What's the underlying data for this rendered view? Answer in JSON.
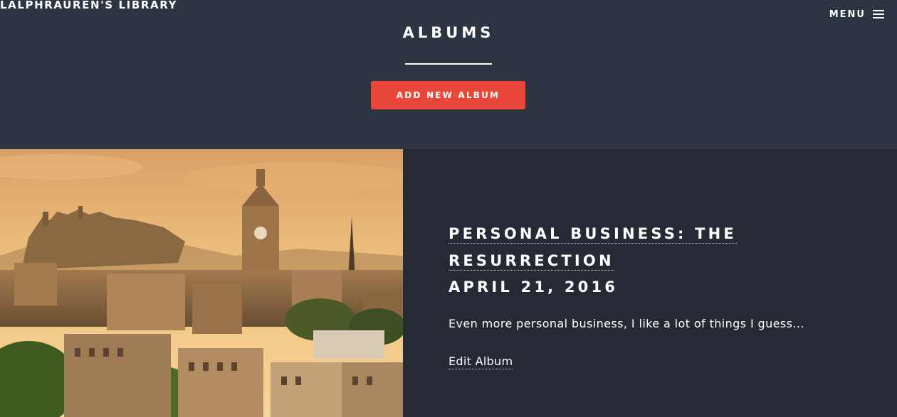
{
  "header": {
    "site_title": "LALPHRAUREN'S LIBRARY",
    "menu_label": "MENU",
    "menu_icon": "hamburger-menu-icon"
  },
  "page": {
    "title": "ALBUMS",
    "add_button_label": "ADD NEW ALBUM"
  },
  "album": {
    "title": "PERSONAL BUSINESS: THE RESURRECTION",
    "date": "APRIL 21, 2016",
    "description": "Even more personal business, I like a lot of things I guess...",
    "edit_label": "Edit Album"
  },
  "colors": {
    "header_bg": "#2e3542",
    "section_bg": "#252a34",
    "accent": "#e9473a"
  }
}
